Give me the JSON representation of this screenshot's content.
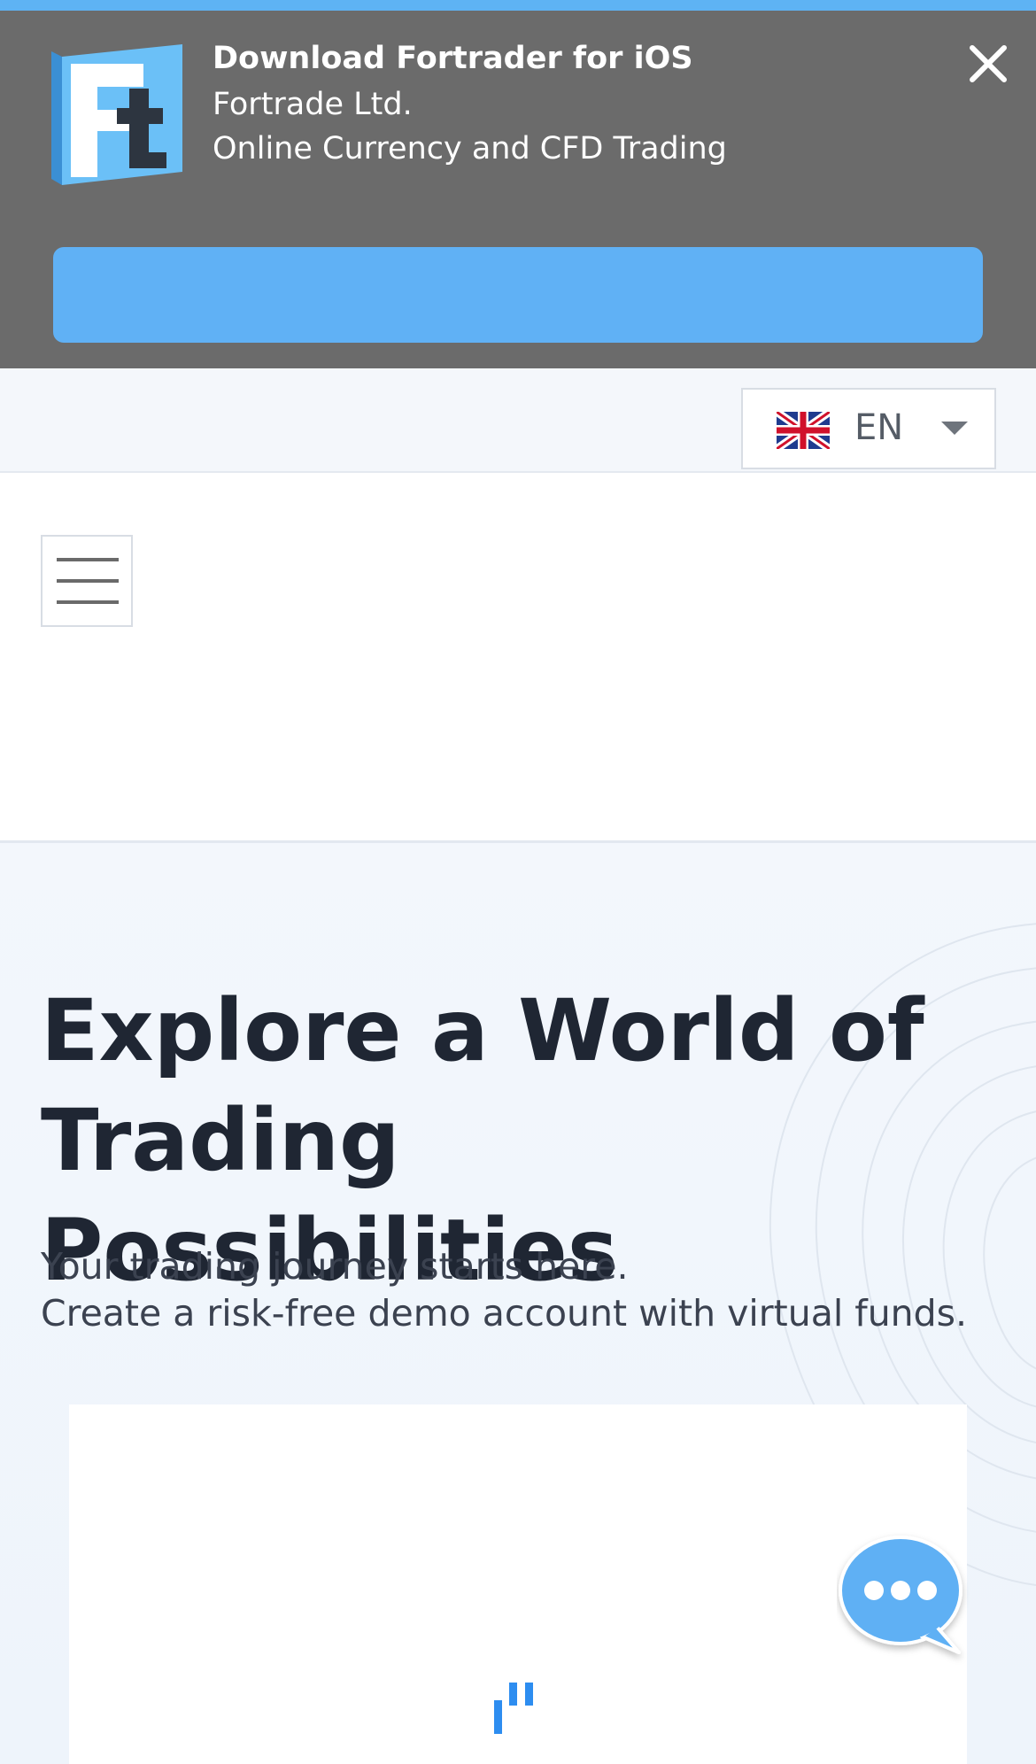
{
  "app_banner": {
    "title": "Download Fortrader for iOS",
    "publisher": "Fortrade Ltd.",
    "tagline": "Online Currency and CFD Trading",
    "logo_icon": "fortrader-logo-icon",
    "close_icon": "close-icon",
    "accent_color": "#60b1f5"
  },
  "language": {
    "code": "EN",
    "flag_icon": "uk-flag-icon"
  },
  "header": {
    "menu_icon": "hamburger-menu-icon"
  },
  "hero": {
    "title": "Explore a World of Trading Possibilities",
    "subtitle_line1": "Your trading journey starts here.",
    "subtitle_line2": "Create a risk-free demo account with virtual funds."
  },
  "chat": {
    "icon": "chat-bubble-icon",
    "color": "#5fb0f4"
  }
}
